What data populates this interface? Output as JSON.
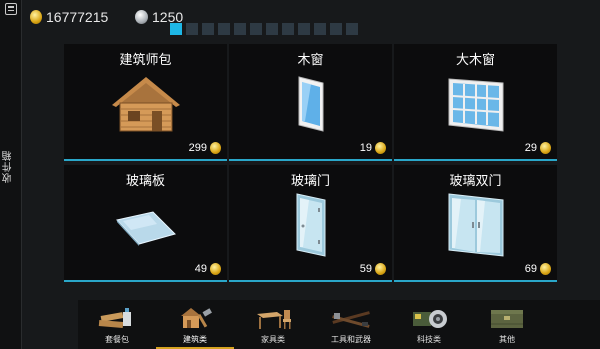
{
  "currency": {
    "gold": "16777215",
    "silver": "1250"
  },
  "side": {
    "label": "收件箱"
  },
  "pagination": {
    "total": 12,
    "active_index": 0
  },
  "items": [
    {
      "name": "建筑师包",
      "price": "299",
      "icon": "wooden-cabin-icon"
    },
    {
      "name": "木窗",
      "price": "19",
      "icon": "wooden-window-icon"
    },
    {
      "name": "大木窗",
      "price": "29",
      "icon": "large-wooden-window-icon"
    },
    {
      "name": "玻璃板",
      "price": "49",
      "icon": "glass-panel-icon"
    },
    {
      "name": "玻璃门",
      "price": "59",
      "icon": "glass-door-icon"
    },
    {
      "name": "玻璃双门",
      "price": "69",
      "icon": "glass-double-door-icon"
    }
  ],
  "tabs": [
    {
      "label": "套餐包",
      "icon": "bundle-icon"
    },
    {
      "label": "建筑类",
      "icon": "building-icon"
    },
    {
      "label": "家具类",
      "icon": "furniture-icon"
    },
    {
      "label": "工具和武器",
      "icon": "tools-weapons-icon"
    },
    {
      "label": "科技类",
      "icon": "tech-icon"
    },
    {
      "label": "其他",
      "icon": "other-crate-icon"
    }
  ],
  "active_tab": 1,
  "colors": {
    "accent_blue": "#1eb7e6",
    "card_line": "#2aa7c9",
    "active_tab_line": "#d6a320",
    "gold": "#d9a514"
  }
}
